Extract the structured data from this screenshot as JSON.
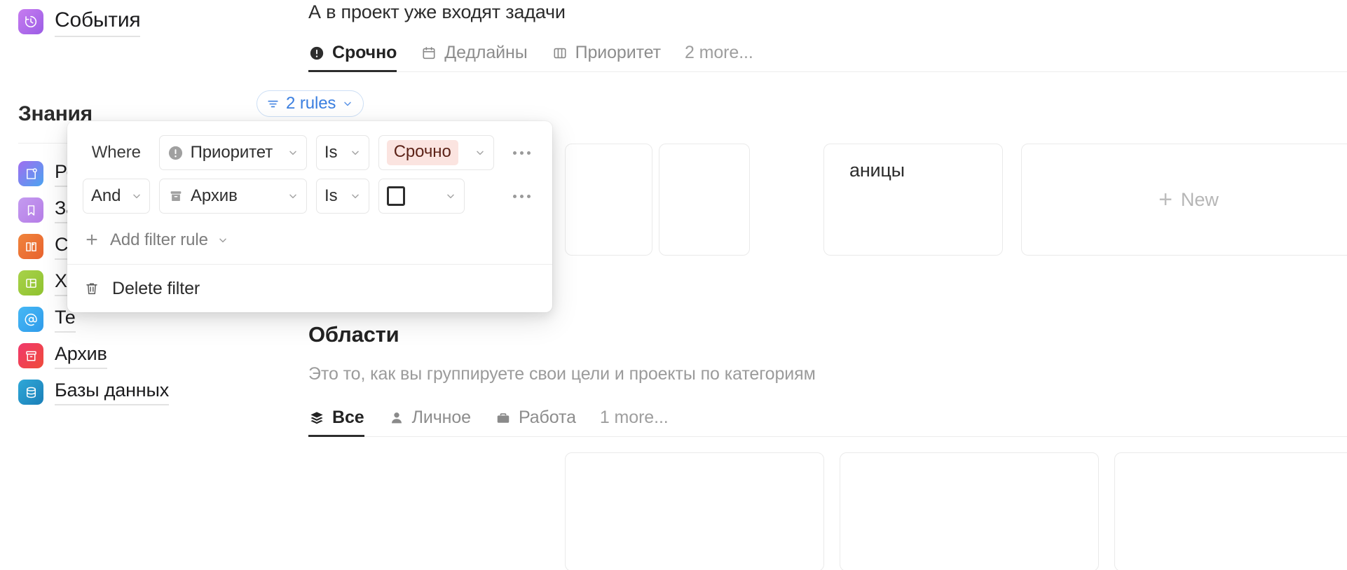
{
  "sidebar": {
    "top_item": {
      "label": "События",
      "icon": "clock-history-icon",
      "color_from": "#c77cf0",
      "color_to": "#9b5de5"
    },
    "section_title": "Знания",
    "items": [
      {
        "label": "Ре",
        "full": "Ресурсы",
        "icon": "note-plus-icon",
        "color_from": "#a06ef0",
        "color_to": "#4aa3f0"
      },
      {
        "label": "За",
        "full": "Закладки",
        "icon": "bookmark-icon",
        "color_from": "#c49bf0",
        "color_to": "#b57ce6"
      },
      {
        "label": "Сп",
        "full": "Справочник",
        "icon": "open-book-icon",
        "color_from": "#f0843c",
        "color_to": "#e8622e"
      },
      {
        "label": "Ха",
        "full": "Хайлайты",
        "icon": "layout-columns-icon",
        "color_from": "#a8d24a",
        "color_to": "#8fc22f"
      },
      {
        "label": "Те",
        "full": "Телеграм",
        "icon": "at-sign-icon",
        "color_from": "#46b8f5",
        "color_to": "#2f9bea"
      },
      {
        "label": "Архив",
        "full": "Архив",
        "icon": "archive-box-icon",
        "color_from": "#f0396c",
        "color_to": "#ef4b3a"
      },
      {
        "label": "Базы данных",
        "full": "Базы данных",
        "icon": "database-icon",
        "color_from": "#2fa8d8",
        "color_to": "#1b7fb8"
      }
    ]
  },
  "main": {
    "projects_block": {
      "title": "А в проект уже входят задачи",
      "tabs": [
        {
          "label": "Срочно",
          "icon": "exclamation-circle-icon",
          "active": true
        },
        {
          "label": "Дедлайны",
          "icon": "calendar-icon",
          "active": false
        },
        {
          "label": "Приоритет",
          "icon": "columns-icon",
          "active": false
        },
        {
          "label": "2 more...",
          "icon": "",
          "active": false
        }
      ],
      "hidden_card_text": "аницы",
      "new_card_label": "New",
      "new_card_plus": "+"
    },
    "areas_block": {
      "title": "Области",
      "subtitle": "Это то, как вы группируете свои цели и проекты по категориям",
      "tabs": [
        {
          "label": "Все",
          "icon": "layers-icon",
          "active": true
        },
        {
          "label": "Личное",
          "icon": "person-icon",
          "active": false
        },
        {
          "label": "Работа",
          "icon": "briefcase-icon",
          "active": false
        },
        {
          "label": "1 more...",
          "icon": "",
          "active": false
        }
      ]
    }
  },
  "filter_chip": {
    "label": "2 rules",
    "icon": "filter-lines-icon",
    "caret": "chevron-down-icon",
    "accent": "#3b7fe0"
  },
  "filter_popover": {
    "rows": [
      {
        "conjunction": "Where",
        "conjunction_is_select": false,
        "property": "Приоритет",
        "property_icon": "exclamation-circle-icon",
        "operator": "Is",
        "value_text": "Срочно",
        "value_kind": "pill",
        "value_pill_bg": "#fbe4e0",
        "value_pill_fg": "#5d2318"
      },
      {
        "conjunction": "And",
        "conjunction_is_select": true,
        "property": "Архив",
        "property_icon": "archive-box-icon",
        "operator": "Is",
        "value_text": "",
        "value_kind": "checkbox"
      }
    ],
    "add_rule_label": "Add filter rule",
    "add_rule_plus": "+",
    "delete_label": "Delete filter",
    "delete_icon": "trash-icon"
  }
}
